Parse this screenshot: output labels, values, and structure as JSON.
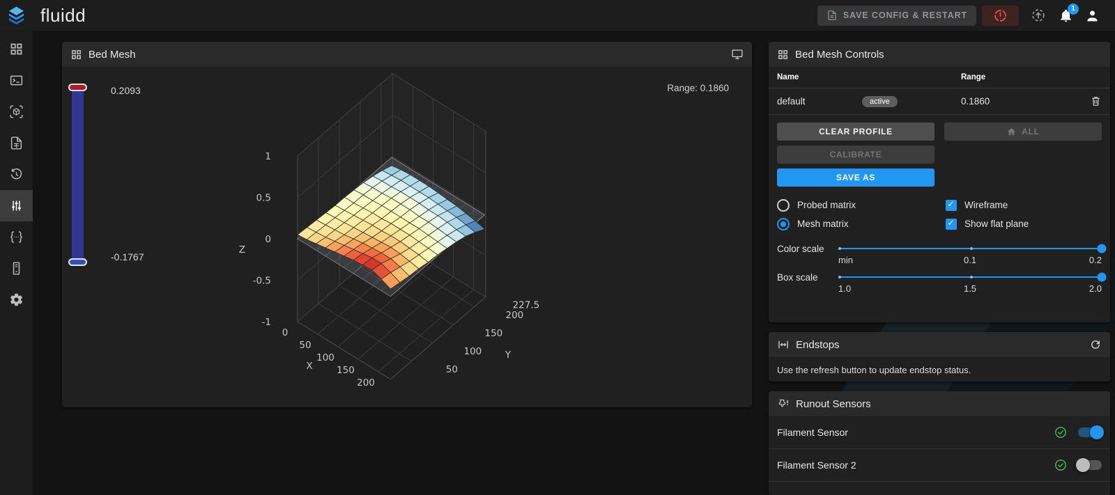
{
  "app": {
    "name": "fluidd"
  },
  "topbar": {
    "save_config_label": "SAVE CONFIG & RESTART",
    "notification_count": "1",
    "icons": [
      "save-file-icon",
      "emergency-stop-icon",
      "host-restart-icon",
      "notifications-bell-icon",
      "account-icon"
    ]
  },
  "sidebar": {
    "items": [
      {
        "id": "dashboard",
        "icon": "dashboard-icon",
        "active": false
      },
      {
        "id": "console",
        "icon": "console-icon",
        "active": false
      },
      {
        "id": "gcode-preview",
        "icon": "cube-scan-icon",
        "active": false
      },
      {
        "id": "jobs",
        "icon": "file-document-icon",
        "active": false
      },
      {
        "id": "history",
        "icon": "history-icon",
        "active": false
      },
      {
        "id": "tune",
        "icon": "tune-icon",
        "active": true
      },
      {
        "id": "configure",
        "icon": "code-braces-icon",
        "active": false
      },
      {
        "id": "system",
        "icon": "server-icon",
        "active": false
      },
      {
        "id": "settings",
        "icon": "gear-icon",
        "active": false
      }
    ]
  },
  "bed_mesh_panel": {
    "title": "Bed Mesh",
    "range_label": "Range: 0.1860"
  },
  "chart_data": {
    "type": "surface3d",
    "range": 0.186,
    "colorbar": {
      "max": "0.2093",
      "min": "-0.1767"
    },
    "z_min": -0.1767,
    "z_max": 0.2093,
    "colormap": [
      "#313695",
      "#4575b4",
      "#74add1",
      "#abd9e9",
      "#e0f3f8",
      "#ffffbf",
      "#fee090",
      "#fdae61",
      "#f46d43",
      "#d73027",
      "#a50026"
    ],
    "axes": {
      "x": {
        "label": "X",
        "ticks": [
          0,
          50,
          100,
          150,
          200
        ],
        "range": [
          0,
          230
        ]
      },
      "y": {
        "label": "Y",
        "ticks": [
          50,
          100,
          150,
          200,
          227.5
        ],
        "range": [
          0,
          227.5
        ]
      },
      "z": {
        "label": "Z",
        "ticks": [
          1,
          0.5,
          0,
          -0.5,
          -1
        ],
        "range": [
          -1,
          1
        ]
      }
    },
    "flat_plane": true,
    "wireframe": true,
    "z_matrix": [
      [
        0.05,
        0.06,
        0.08,
        0.1,
        0.12,
        0.14,
        0.16,
        0.17,
        0.18,
        0.14,
        0.09
      ],
      [
        0.04,
        0.05,
        0.06,
        0.08,
        0.1,
        0.12,
        0.14,
        0.16,
        0.16,
        0.12,
        0.07
      ],
      [
        0.03,
        0.04,
        0.05,
        0.06,
        0.08,
        0.1,
        0.11,
        0.12,
        0.12,
        0.09,
        0.05
      ],
      [
        0.02,
        0.03,
        0.04,
        0.05,
        0.06,
        0.07,
        0.08,
        0.09,
        0.08,
        0.06,
        0.04
      ],
      [
        0.01,
        0.02,
        0.03,
        0.04,
        0.05,
        0.05,
        0.06,
        0.06,
        0.05,
        0.04,
        0.02
      ],
      [
        0.01,
        0.01,
        0.02,
        0.03,
        0.03,
        0.04,
        0.04,
        0.04,
        0.03,
        0.02,
        0.01
      ],
      [
        0.0,
        0.01,
        0.01,
        0.02,
        0.02,
        0.02,
        0.02,
        0.02,
        0.01,
        0.0,
        -0.01
      ],
      [
        -0.01,
        0.0,
        0.0,
        0.01,
        0.01,
        0.01,
        0.0,
        0.0,
        -0.01,
        -0.02,
        -0.03
      ],
      [
        -0.03,
        -0.02,
        -0.02,
        -0.01,
        -0.01,
        -0.01,
        -0.02,
        -0.02,
        -0.03,
        -0.05,
        -0.06
      ],
      [
        -0.06,
        -0.05,
        -0.04,
        -0.04,
        -0.04,
        -0.04,
        -0.05,
        -0.06,
        -0.07,
        -0.09,
        -0.11
      ],
      [
        -0.1,
        -0.08,
        -0.07,
        -0.07,
        -0.07,
        -0.08,
        -0.09,
        -0.1,
        -0.12,
        -0.14,
        -0.17
      ]
    ]
  },
  "controls_panel": {
    "title": "Bed Mesh Controls",
    "table": {
      "headers": [
        "Name",
        "Range"
      ],
      "rows": [
        {
          "name": "default",
          "badge": "active",
          "range": "0.1860"
        }
      ]
    },
    "buttons": {
      "clear_profile": "CLEAR PROFILE",
      "all": "ALL",
      "calibrate": "CALIBRATE",
      "save_as": "SAVE AS"
    },
    "radios": [
      {
        "label": "Probed matrix",
        "checked": false
      },
      {
        "label": "Mesh matrix",
        "checked": true
      }
    ],
    "checkboxes": [
      {
        "label": "Wireframe",
        "checked": true
      },
      {
        "label": "Show flat plane",
        "checked": true
      }
    ],
    "sliders": [
      {
        "label": "Color scale",
        "ticks": [
          "min",
          "0.1",
          "0.2"
        ],
        "value_pos": 1.0
      },
      {
        "label": "Box scale",
        "ticks": [
          "1.0",
          "1.5",
          "2.0"
        ],
        "value_pos": 1.0
      }
    ]
  },
  "endstops_panel": {
    "title": "Endstops",
    "message": "Use the refresh button to update endstop status."
  },
  "runout_panel": {
    "title": "Runout Sensors",
    "sensors": [
      {
        "label": "Filament Sensor",
        "enabled": true
      },
      {
        "label": "Filament Sensor 2",
        "enabled": false
      }
    ]
  },
  "colors": {
    "accent": "#2196f3",
    "estop": "#f44336",
    "success": "#4caf50"
  }
}
